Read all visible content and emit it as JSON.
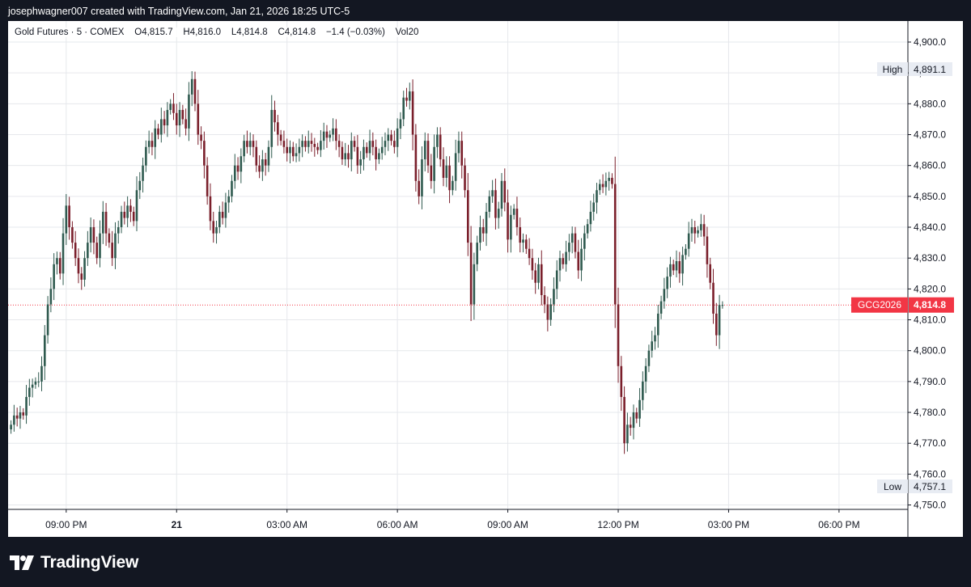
{
  "header": {
    "attribution": "josephwagner007 created with TradingView.com, Jan 21, 2026 18:25 UTC-5"
  },
  "legend": {
    "symbol": "Gold Futures · 5 · COMEX",
    "open": "O4,815.7",
    "high": "H4,816.0",
    "low": "L4,814.8",
    "close": "C4,814.8",
    "change": "−1.4 (−0.03%)",
    "volume": "Vol20"
  },
  "price_axis": {
    "ticks": [
      "4,900.0",
      "4,890.0",
      "4,880.0",
      "4,870.0",
      "4,860.0",
      "4,850.0",
      "4,840.0",
      "4,830.0",
      "4,820.0",
      "4,810.0",
      "4,800.0",
      "4,790.0",
      "4,780.0",
      "4,770.0",
      "4,760.0",
      "4,750.0"
    ],
    "high_label": "High",
    "high_value": "4,891.1",
    "low_label": "Low",
    "low_value": "4,757.1",
    "symbol_tag": "GCG2026",
    "last_price": "4,814.8"
  },
  "time_axis": {
    "labels": [
      "09:00 PM",
      "21",
      "03:00 AM",
      "06:00 AM",
      "09:00 AM",
      "12:00 PM",
      "03:00 PM",
      "06:00 PM"
    ]
  },
  "branding": {
    "logo_text": "TradingView"
  },
  "colors": {
    "up": "#2f5a4f",
    "down": "#7a1f2b",
    "last_price": "#f23645",
    "grid": "#e6e8ec",
    "axis_text": "#131722"
  },
  "chart_data": {
    "type": "candlestick",
    "title": "Gold Futures · 5 · COMEX",
    "interval": "5 min",
    "ylim": [
      4748,
      4905
    ],
    "grid": true,
    "last_price": 4814.8,
    "high": 4891.1,
    "low": 4757.1,
    "x_ticks": [
      {
        "label": "09:00 PM",
        "bar": 18
      },
      {
        "label": "21",
        "bar": 54
      },
      {
        "label": "03:00 AM",
        "bar": 90
      },
      {
        "label": "06:00 AM",
        "bar": 126
      },
      {
        "label": "09:00 AM",
        "bar": 162
      },
      {
        "label": "12:00 PM",
        "bar": 198
      },
      {
        "label": "03:00 PM",
        "bar": 234
      },
      {
        "label": "06:00 PM",
        "bar": 270
      }
    ],
    "close": [
      4776,
      4779,
      4778,
      4780,
      4779,
      4785,
      4788,
      4789,
      4790,
      4790,
      4795,
      4805,
      4815,
      4820,
      4828,
      4830,
      4825,
      4838,
      4847,
      4840,
      4835,
      4830,
      4825,
      4823,
      4830,
      4835,
      4840,
      4835,
      4830,
      4838,
      4845,
      4838,
      4835,
      4830,
      4838,
      4840,
      4845,
      4843,
      4847,
      4845,
      4842,
      4852,
      4855,
      4860,
      4866,
      4868,
      4866,
      4872,
      4870,
      4875,
      4873,
      4878,
      4880,
      4877,
      4873,
      4878,
      4875,
      4872,
      4883,
      4888,
      4880,
      4870,
      4868,
      4860,
      4850,
      4842,
      4838,
      4840,
      4845,
      4843,
      4848,
      4850,
      4855,
      4860,
      4858,
      4863,
      4868,
      4866,
      4868,
      4866,
      4860,
      4858,
      4862,
      4860,
      4866,
      4878,
      4874,
      4870,
      4868,
      4866,
      4864,
      4866,
      4863,
      4864,
      4866,
      4868,
      4866,
      4868,
      4867,
      4866,
      4865,
      4868,
      4871,
      4869,
      4870,
      4872,
      4868,
      4866,
      4862,
      4864,
      4862,
      4868,
      4866,
      4860,
      4862,
      4866,
      4864,
      4868,
      4866,
      4862,
      4864,
      4866,
      4868,
      4870,
      4868,
      4866,
      4872,
      4875,
      4882,
      4881,
      4884,
      4870,
      4855,
      4850,
      4862,
      4868,
      4860,
      4855,
      4866,
      4870,
      4862,
      4856,
      4860,
      4852,
      4855,
      4864,
      4868,
      4860,
      4852,
      4835,
      4815,
      4828,
      4835,
      4840,
      4838,
      4845,
      4850,
      4852,
      4843,
      4846,
      4855,
      4848,
      4836,
      4844,
      4846,
      4840,
      4835,
      4836,
      4833,
      4830,
      4826,
      4822,
      4828,
      4818,
      4815,
      4810,
      4815,
      4820,
      4826,
      4830,
      4828,
      4832,
      4835,
      4838,
      4832,
      4826,
      4833,
      4838,
      4841,
      4845,
      4848,
      4852,
      4854,
      4853,
      4855,
      4856,
      4854,
      4815,
      4795,
      4785,
      4770,
      4776,
      4775,
      4780,
      4778,
      4784,
      4790,
      4795,
      4800,
      4803,
      4805,
      4812,
      4816,
      4820,
      4824,
      4828,
      4826,
      4829,
      4825,
      4831,
      4833,
      4838,
      4840,
      4838,
      4839,
      4841,
      4837,
      4828,
      4822,
      4812,
      4805,
      4814.8,
      4814.8
    ]
  }
}
